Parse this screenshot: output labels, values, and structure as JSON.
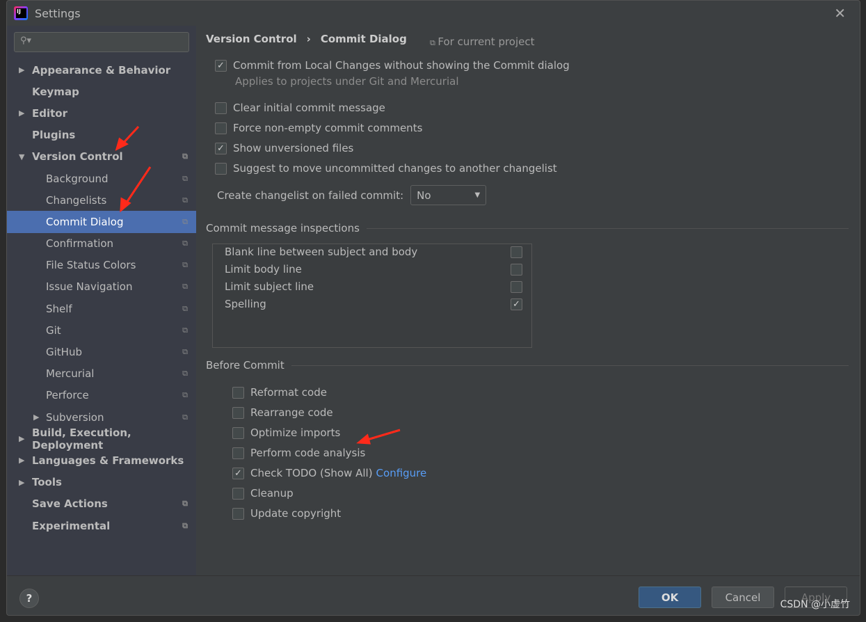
{
  "window": {
    "title": "Settings"
  },
  "search": {
    "placeholder": ""
  },
  "sidebar": {
    "items": [
      {
        "label": "Appearance & Behavior",
        "level": 0,
        "expandable": true,
        "expanded": false,
        "project": false
      },
      {
        "label": "Keymap",
        "level": 0,
        "expandable": false,
        "project": false
      },
      {
        "label": "Editor",
        "level": 0,
        "expandable": true,
        "expanded": false,
        "project": false
      },
      {
        "label": "Plugins",
        "level": 0,
        "expandable": false,
        "project": false
      },
      {
        "label": "Version Control",
        "level": 0,
        "expandable": true,
        "expanded": true,
        "project": true
      },
      {
        "label": "Background",
        "level": 1,
        "project": true
      },
      {
        "label": "Changelists",
        "level": 1,
        "project": true
      },
      {
        "label": "Commit Dialog",
        "level": 1,
        "project": true,
        "selected": true
      },
      {
        "label": "Confirmation",
        "level": 1,
        "project": true
      },
      {
        "label": "File Status Colors",
        "level": 1,
        "project": true
      },
      {
        "label": "Issue Navigation",
        "level": 1,
        "project": true
      },
      {
        "label": "Shelf",
        "level": 1,
        "project": true
      },
      {
        "label": "Git",
        "level": 1,
        "project": true
      },
      {
        "label": "GitHub",
        "level": 1,
        "project": true
      },
      {
        "label": "Mercurial",
        "level": 1,
        "project": true
      },
      {
        "label": "Perforce",
        "level": 1,
        "project": true
      },
      {
        "label": "Subversion",
        "level": 1,
        "expandable": true,
        "expanded": false,
        "project": true
      },
      {
        "label": "Build, Execution, Deployment",
        "level": 0,
        "expandable": true,
        "expanded": false,
        "project": false
      },
      {
        "label": "Languages & Frameworks",
        "level": 0,
        "expandable": true,
        "expanded": false,
        "project": false
      },
      {
        "label": "Tools",
        "level": 0,
        "expandable": true,
        "expanded": false,
        "project": false
      },
      {
        "label": "Save Actions",
        "level": 0,
        "expandable": false,
        "project": true
      },
      {
        "label": "Experimental",
        "level": 0,
        "expandable": false,
        "project": true
      }
    ]
  },
  "main": {
    "breadcrumb": [
      "Version Control",
      "›",
      "Commit Dialog"
    ],
    "scope": "For current project",
    "options": [
      {
        "label": "Commit from Local Changes without showing the Commit dialog",
        "checked": true
      },
      {
        "label": "Clear initial commit message",
        "checked": false
      },
      {
        "label": "Force non-empty commit comments",
        "checked": false
      },
      {
        "label": "Show unversioned files",
        "checked": true
      },
      {
        "label": "Suggest to move uncommitted changes to another changelist",
        "checked": false
      }
    ],
    "hint": "Applies to projects under Git and Mercurial",
    "changelist_label": "Create changelist on failed commit:",
    "changelist_value": "No",
    "inspections_title": "Commit message inspections",
    "inspections": [
      {
        "label": "Blank line between subject and body",
        "checked": false
      },
      {
        "label": "Limit body line",
        "checked": false
      },
      {
        "label": "Limit subject line",
        "checked": false
      },
      {
        "label": "Spelling",
        "checked": true
      }
    ],
    "before_title": "Before Commit",
    "before": [
      {
        "label": "Reformat code",
        "checked": false
      },
      {
        "label": "Rearrange code",
        "checked": false
      },
      {
        "label": "Optimize imports",
        "checked": false
      },
      {
        "label": "Perform code analysis",
        "checked": false
      },
      {
        "label": "Check TODO (Show All)",
        "checked": true,
        "link": "Configure"
      },
      {
        "label": "Cleanup",
        "checked": false
      },
      {
        "label": "Update copyright",
        "checked": false
      }
    ]
  },
  "footer": {
    "help": "?",
    "ok": "OK",
    "cancel": "Cancel",
    "apply": "Apply"
  },
  "watermark": "CSDN @小虚竹",
  "colors": {
    "selection": "#4b6eaf",
    "link": "#589df6",
    "annotation": "#ff2a1a"
  }
}
